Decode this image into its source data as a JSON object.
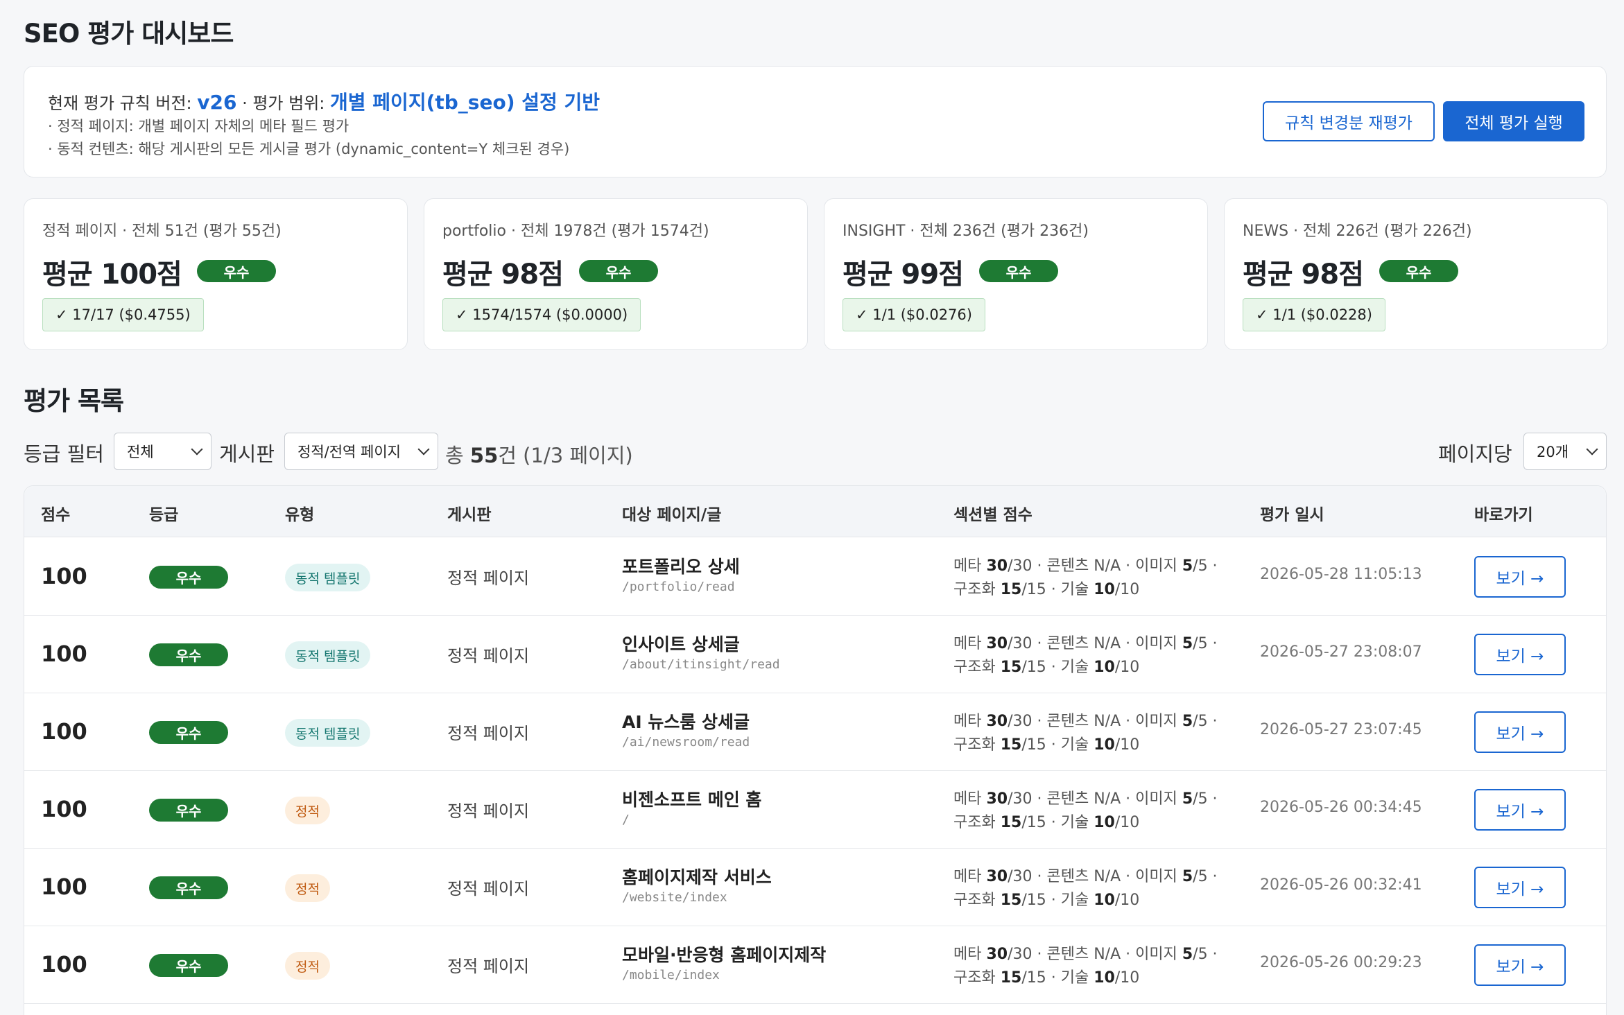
{
  "page": {
    "title": "SEO 평가 대시보드"
  },
  "rules": {
    "version_label": "현재 평가 규칙 버전: ",
    "version": "v26",
    "scope_label": " · 평가 범위: ",
    "scope": "개별 페이지(tb_seo) 설정 기반",
    "note_static": "· 정적 페이지: 개별 페이지 자체의 메타 필드 평가",
    "note_dynamic": "· 동적 컨텐츠: 해당 게시판의 모든 게시글 평가 (dynamic_content=Y 체크된 경우)",
    "reeval_button": "규칙 변경분 재평가",
    "run_all_button": "전체 평가 실행"
  },
  "summary_cards": [
    {
      "head": "정적 페이지 · 전체 51건 (평가 55건)",
      "avg": "평균 100점",
      "grade": "우수",
      "cost": "✓ 17/17 ($0.4755)"
    },
    {
      "head": "portfolio · 전체 1978건 (평가 1574건)",
      "avg": "평균 98점",
      "grade": "우수",
      "cost": "✓ 1574/1574 ($0.0000)"
    },
    {
      "head": "INSIGHT · 전체 236건 (평가 236건)",
      "avg": "평균 99점",
      "grade": "우수",
      "cost": "✓ 1/1 ($0.0276)"
    },
    {
      "head": "NEWS · 전체 226건 (평가 226건)",
      "avg": "평균 98점",
      "grade": "우수",
      "cost": "✓ 1/1 ($0.0228)"
    }
  ],
  "list": {
    "title": "평가 목록",
    "grade_filter_label": "등급 필터",
    "grade_filter_value": "전체",
    "board_label": "게시판",
    "board_value": "정적/전역 페이지",
    "total_prefix": "총 ",
    "total_count": "55",
    "total_suffix": "건 (1/3 페이지)",
    "per_page_label": "페이지당",
    "per_page_value": "20개"
  },
  "table": {
    "headers": [
      "점수",
      "등급",
      "유형",
      "게시판",
      "대상 페이지/글",
      "섹션별 점수",
      "평가 일시",
      "바로가기"
    ],
    "section_labels": {
      "meta": "메타 ",
      "content": " · 콘텐츠 ",
      "image": " · 이미지 ",
      "struct": "구조화 ",
      "tech": " · 기술 "
    },
    "rows": [
      {
        "score": "100",
        "grade": "우수",
        "type": "동적 템플릿",
        "type_kind": "dyn",
        "board": "정적 페이지",
        "name": "포트폴리오 상세",
        "path": "/portfolio/read",
        "meta": "30",
        "meta_max": "/30",
        "content": "N/A",
        "image": "5",
        "image_max": "/5 ·",
        "struct": "15",
        "struct_max": "/15",
        "tech": "10",
        "tech_max": "/10",
        "date": "2026-05-28 11:05:13",
        "action": "보기 →"
      },
      {
        "score": "100",
        "grade": "우수",
        "type": "동적 템플릿",
        "type_kind": "dyn",
        "board": "정적 페이지",
        "name": "인사이트 상세글",
        "path": "/about/itinsight/read",
        "meta": "30",
        "meta_max": "/30",
        "content": "N/A",
        "image": "5",
        "image_max": "/5 ·",
        "struct": "15",
        "struct_max": "/15",
        "tech": "10",
        "tech_max": "/10",
        "date": "2026-05-27 23:08:07",
        "action": "보기 →"
      },
      {
        "score": "100",
        "grade": "우수",
        "type": "동적 템플릿",
        "type_kind": "dyn",
        "board": "정적 페이지",
        "name": "AI 뉴스룸 상세글",
        "path": "/ai/newsroom/read",
        "meta": "30",
        "meta_max": "/30",
        "content": "N/A",
        "image": "5",
        "image_max": "/5 ·",
        "struct": "15",
        "struct_max": "/15",
        "tech": "10",
        "tech_max": "/10",
        "date": "2026-05-27 23:07:45",
        "action": "보기 →"
      },
      {
        "score": "100",
        "grade": "우수",
        "type": "정적",
        "type_kind": "static",
        "board": "정적 페이지",
        "name": "비젠소프트 메인 홈",
        "path": "/",
        "meta": "30",
        "meta_max": "/30",
        "content": "N/A",
        "image": "5",
        "image_max": "/5 ·",
        "struct": "15",
        "struct_max": "/15",
        "tech": "10",
        "tech_max": "/10",
        "date": "2026-05-26 00:34:45",
        "action": "보기 →"
      },
      {
        "score": "100",
        "grade": "우수",
        "type": "정적",
        "type_kind": "static",
        "board": "정적 페이지",
        "name": "홈페이지제작 서비스",
        "path": "/website/index",
        "meta": "30",
        "meta_max": "/30",
        "content": "N/A",
        "image": "5",
        "image_max": "/5 ·",
        "struct": "15",
        "struct_max": "/15",
        "tech": "10",
        "tech_max": "/10",
        "date": "2026-05-26 00:32:41",
        "action": "보기 →"
      },
      {
        "score": "100",
        "grade": "우수",
        "type": "정적",
        "type_kind": "static",
        "board": "정적 페이지",
        "name": "모바일·반응형 홈페이지제작",
        "path": "/mobile/index",
        "meta": "30",
        "meta_max": "/30",
        "content": "N/A",
        "image": "5",
        "image_max": "/5 ·",
        "struct": "15",
        "struct_max": "/15",
        "tech": "10",
        "tech_max": "/10",
        "date": "2026-05-26 00:29:23",
        "action": "보기 →"
      }
    ]
  }
}
